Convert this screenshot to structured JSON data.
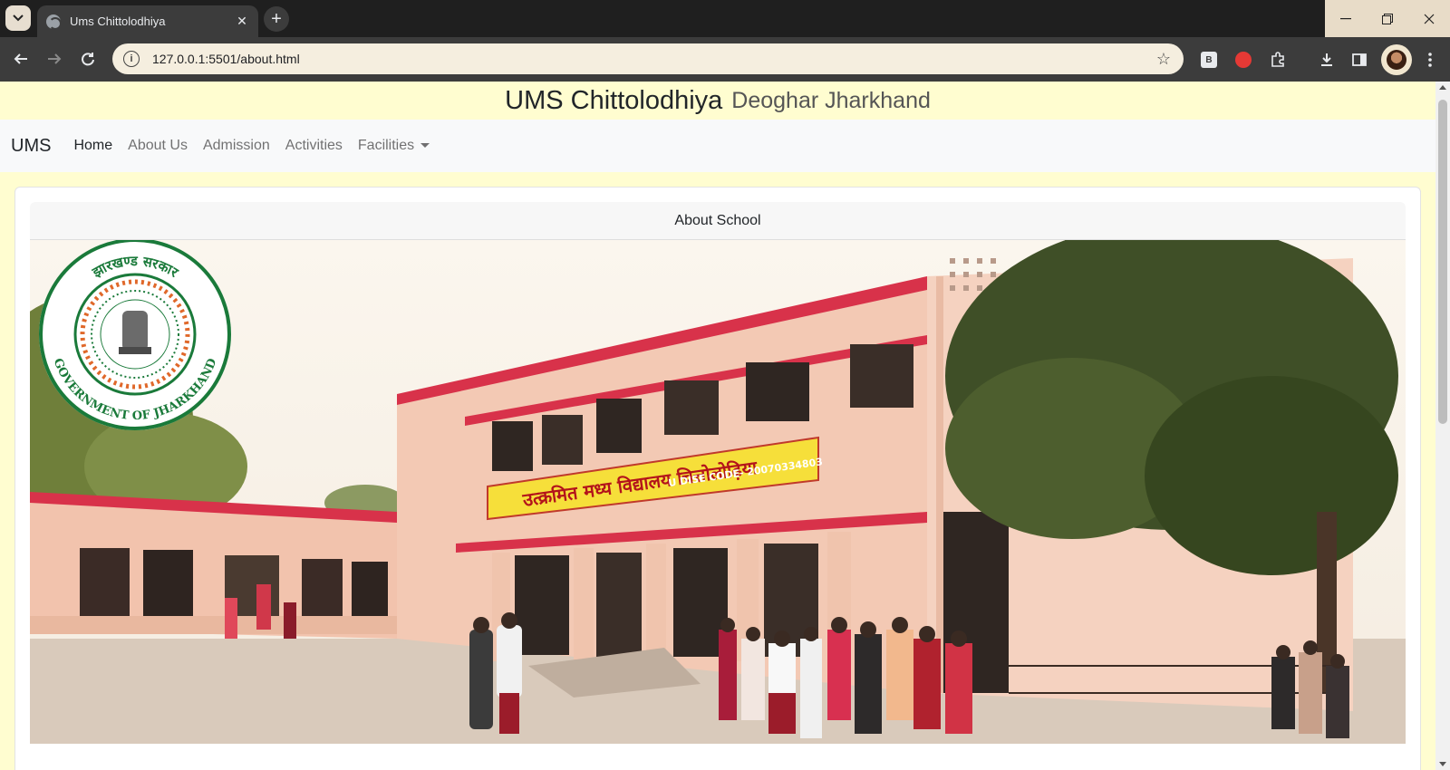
{
  "browser": {
    "tab_title": "Ums Chittolodhiya",
    "url": "127.0.0.1:5501/about.html",
    "extension_b_label": "B"
  },
  "site": {
    "school_name": "UMS Chittolodhiya",
    "location": "Deoghar Jharkhand"
  },
  "navbar": {
    "brand": "UMS",
    "links": [
      "Home",
      "About Us",
      "Admission",
      "Activities",
      "Facilities"
    ]
  },
  "card": {
    "header": "About School"
  },
  "photo": {
    "seal_top_text": "झारखण्ड सरकार",
    "seal_bottom_text": "GOVERNMENT OF JHARKHAND",
    "signboard_text": "उत्क्रमित मध्य विद्यालय चित्तोलोढ़िया",
    "udise_text": "U DISE CODE- 20070334803"
  },
  "colors": {
    "page_bg": "#fffdd0",
    "navbar_bg": "#f8f9fa",
    "building_pink": "#f3c9b4",
    "trim_red": "#d8324a"
  }
}
